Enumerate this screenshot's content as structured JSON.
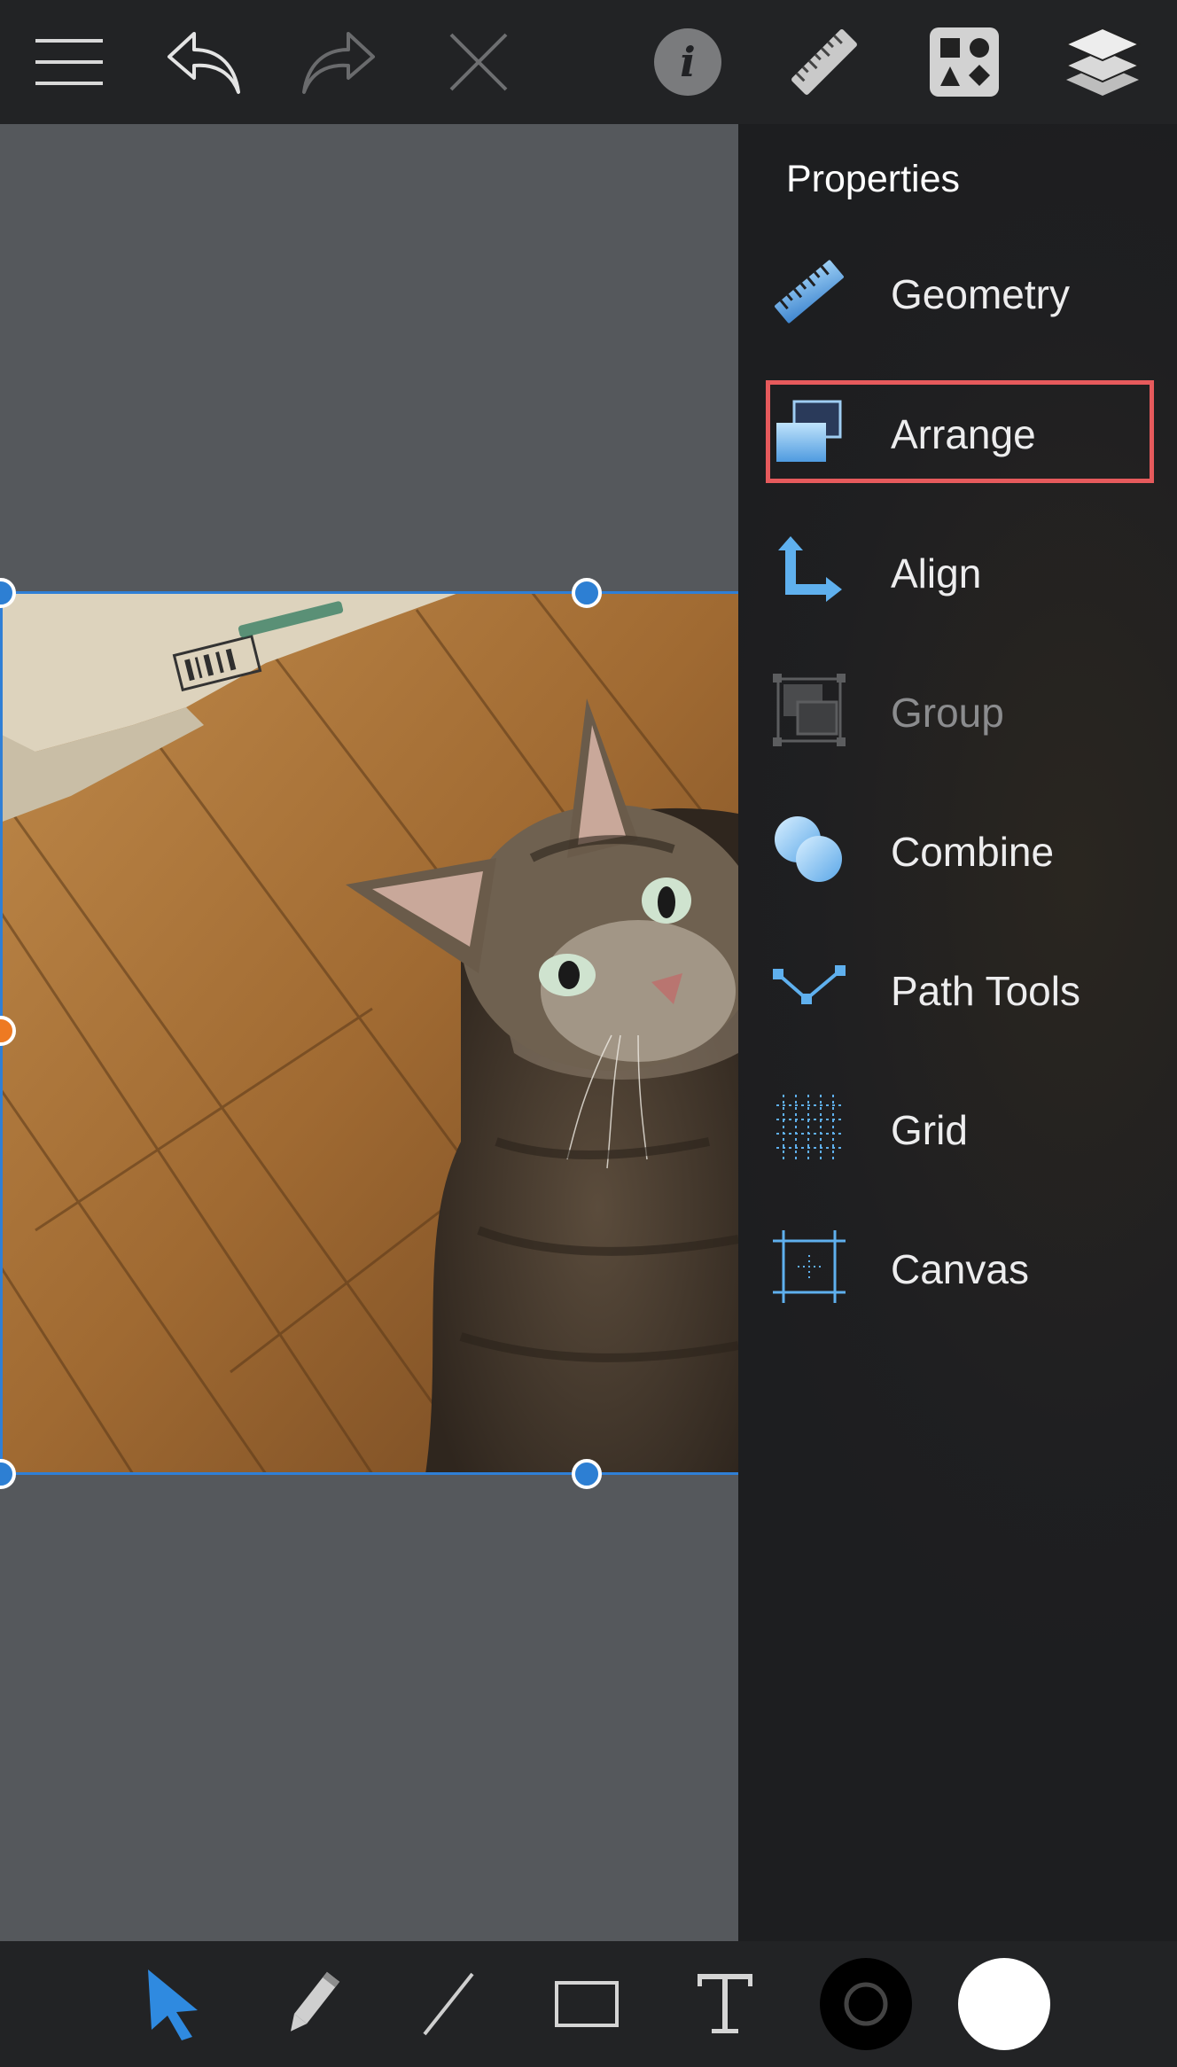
{
  "toolbar": {
    "items": [
      {
        "name": "menu-icon"
      },
      {
        "name": "undo-icon"
      },
      {
        "name": "redo-icon"
      },
      {
        "name": "delete-icon"
      },
      {
        "name": "info-icon"
      },
      {
        "name": "ruler-icon"
      },
      {
        "name": "shapes-library-icon"
      },
      {
        "name": "layers-icon"
      }
    ]
  },
  "properties": {
    "title": "Properties",
    "selected": "Arrange",
    "items": [
      {
        "label": "Geometry",
        "icon": "ruler-icon",
        "enabled": true
      },
      {
        "label": "Arrange",
        "icon": "arrange-icon",
        "enabled": true
      },
      {
        "label": "Align",
        "icon": "align-icon",
        "enabled": true
      },
      {
        "label": "Group",
        "icon": "group-icon",
        "enabled": false
      },
      {
        "label": "Combine",
        "icon": "combine-icon",
        "enabled": true
      },
      {
        "label": "Path Tools",
        "icon": "path-tools-icon",
        "enabled": true
      },
      {
        "label": "Grid",
        "icon": "grid-icon",
        "enabled": true
      },
      {
        "label": "Canvas",
        "icon": "canvas-icon",
        "enabled": true
      }
    ]
  },
  "canvas": {
    "image": "cat-photo",
    "selection_color": "#2f7fd6",
    "handle_color": "#2d7fd3",
    "rotation_handle_color": "#ee7a22"
  },
  "bottom_tools": {
    "items": [
      {
        "name": "select-tool-icon",
        "active": true
      },
      {
        "name": "pencil-tool-icon"
      },
      {
        "name": "line-tool-icon"
      },
      {
        "name": "rectangle-tool-icon"
      },
      {
        "name": "text-tool-icon"
      },
      {
        "name": "stroke-color-swatch",
        "color": "#000000"
      },
      {
        "name": "fill-color-swatch",
        "color": "#ffffff"
      }
    ]
  },
  "colors": {
    "accent": "#3a8fe0",
    "highlight_outline": "#e65a5c",
    "panel_bg": "#1f1f21",
    "canvas_bg": "#55585c"
  }
}
